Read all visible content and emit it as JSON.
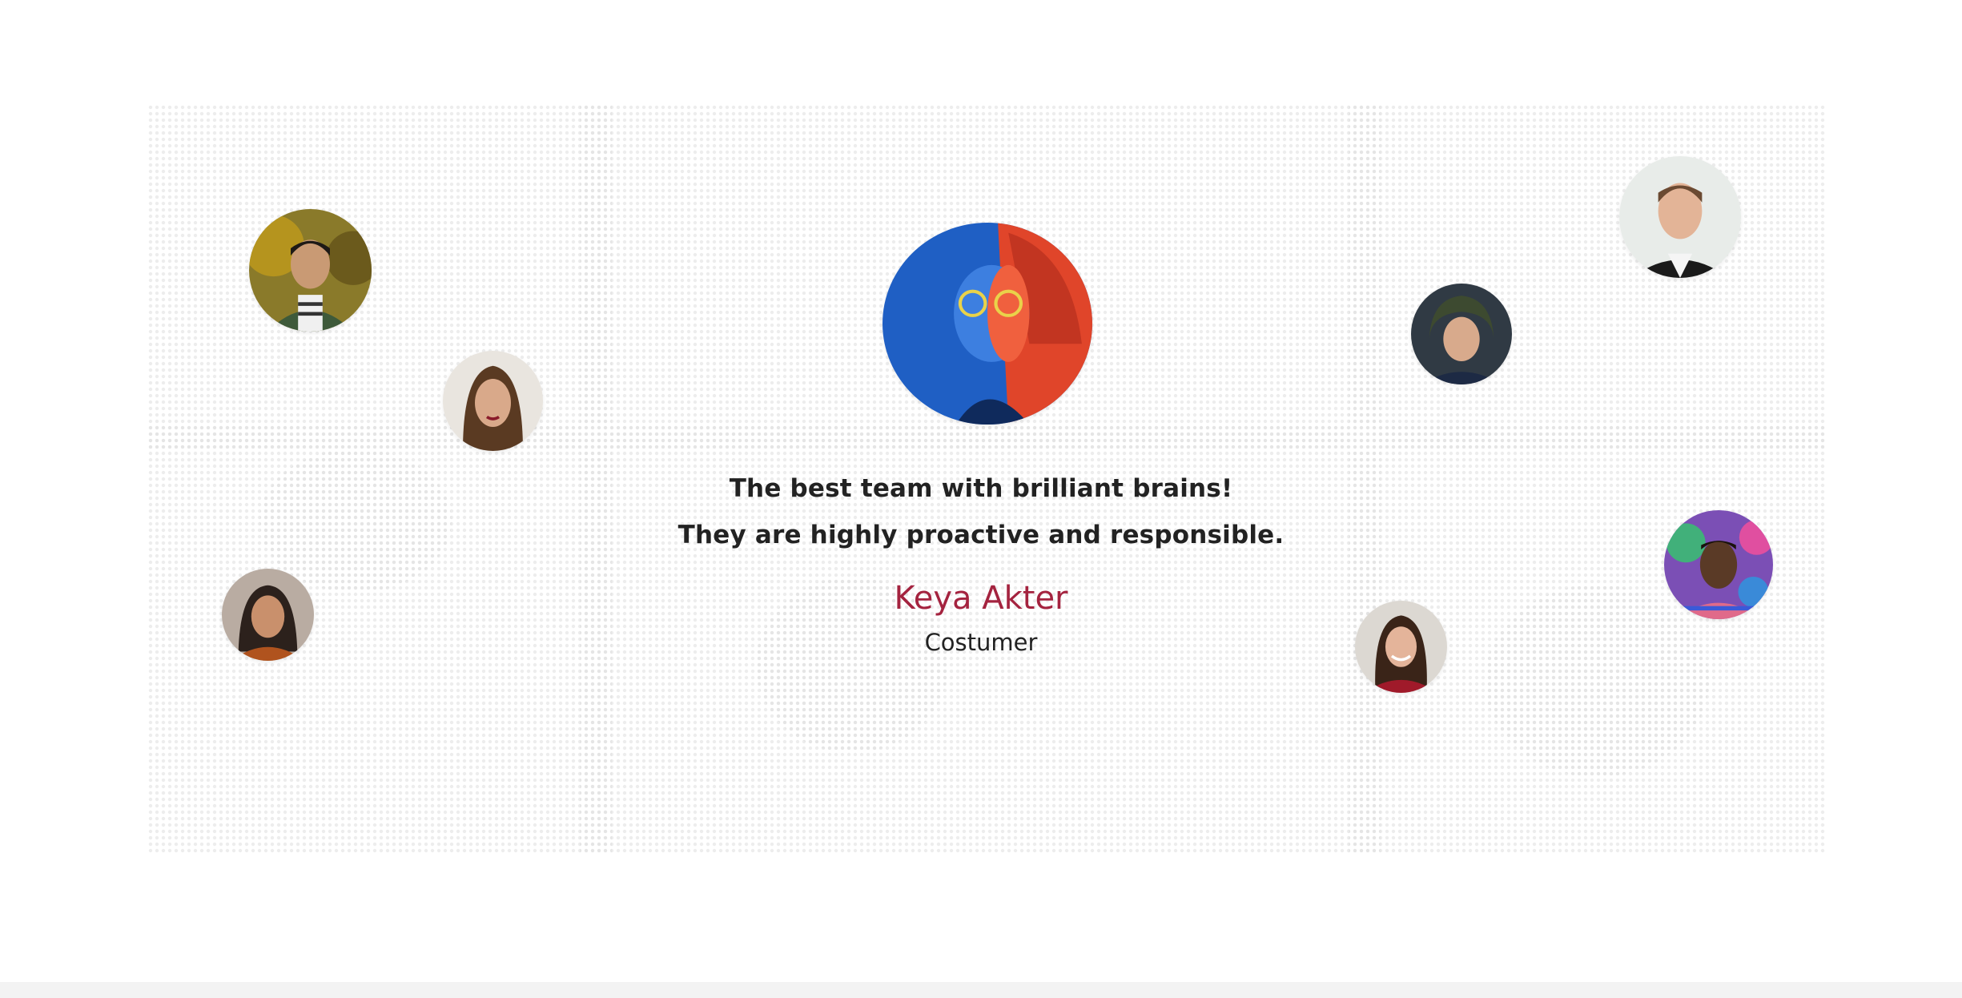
{
  "testimonial": {
    "quote_line_1": "The best team with brilliant brains!",
    "quote_line_2": "They are highly proactive and responsible.",
    "name": "Keya Akter",
    "role": "Costumer"
  },
  "colors": {
    "name_accent": "#a4233f",
    "text": "#222222",
    "map_dots": "#e3e3e3"
  },
  "avatars": [
    {
      "id": "main",
      "icon": "person-photo"
    },
    {
      "id": "left-top",
      "icon": "person-photo"
    },
    {
      "id": "left-middle",
      "icon": "person-photo"
    },
    {
      "id": "left-bottom",
      "icon": "person-photo"
    },
    {
      "id": "right-top",
      "icon": "person-photo"
    },
    {
      "id": "right-upper",
      "icon": "person-photo"
    },
    {
      "id": "right-middle",
      "icon": "person-photo"
    },
    {
      "id": "right-bottom",
      "icon": "person-photo"
    }
  ]
}
